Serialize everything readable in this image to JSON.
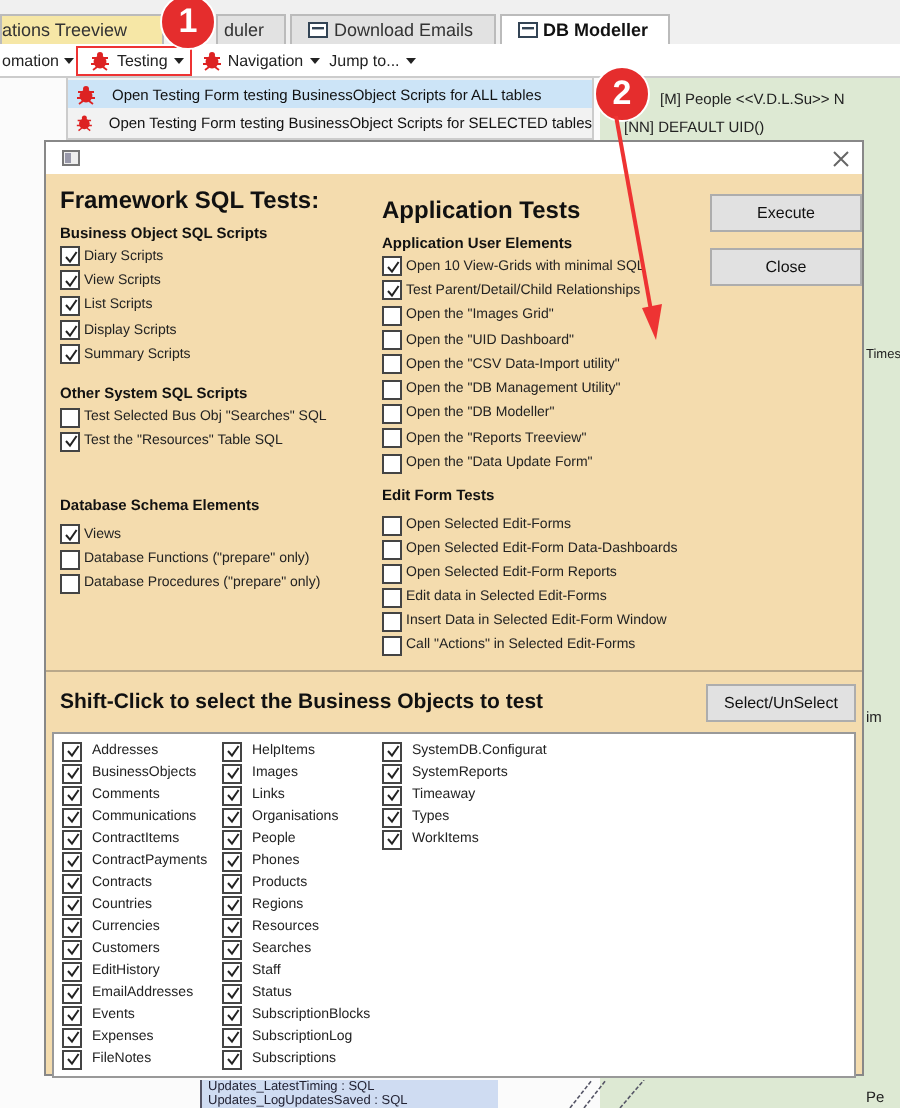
{
  "app": {
    "tabs": [
      {
        "label": "ations Treeview",
        "selected": false,
        "has_icon": false
      },
      {
        "label": "duler",
        "selected": false,
        "has_icon": false
      },
      {
        "label": "Download Emails",
        "selected": false,
        "has_icon": true
      },
      {
        "label": "DB Modeller",
        "selected": true,
        "has_icon": true
      }
    ],
    "toolbar": [
      {
        "label": "omation",
        "has_icon": false,
        "highlighted": false
      },
      {
        "label": "Testing",
        "has_icon": true,
        "highlighted": true
      },
      {
        "label": "Navigation",
        "has_icon": true,
        "highlighted": false
      },
      {
        "label": "Jump to...",
        "has_icon": false,
        "highlighted": false
      }
    ],
    "diagram_texts": [
      {
        "text": "[M] People <<V.D.L.Su>> N",
        "kind": "header"
      },
      {
        "text": "[NN] DEFAULT UID()",
        "kind": "field"
      },
      {
        "text": "Times",
        "kind": "side"
      },
      {
        "text": "im",
        "kind": "side2"
      },
      {
        "text": "Pe",
        "kind": "side3"
      }
    ],
    "diagram_rows": [
      "Updates_LatestTiming : SQL",
      "Updates_LogUpdatesSaved : SQL"
    ]
  },
  "menu": {
    "items": [
      {
        "label": "Open Testing Form testing BusinessObject Scripts for ALL tables",
        "selected": true
      },
      {
        "label": "Open Testing Form testing BusinessObject Scripts for SELECTED tables",
        "selected": false
      }
    ]
  },
  "dialog": {
    "sections": [
      {
        "title": "Framework SQL Tests:",
        "groups": [
          {
            "title": "Business Object SQL Scripts",
            "options": [
              {
                "label": "Diary Scripts",
                "checked": true
              },
              {
                "label": "View Scripts",
                "checked": true
              },
              {
                "label": "List Scripts",
                "checked": true
              },
              {
                "label": "Display Scripts",
                "checked": true
              },
              {
                "label": "Summary Scripts",
                "checked": true
              }
            ]
          },
          {
            "title": "Other System SQL Scripts",
            "options": [
              {
                "label": "Test Selected Bus Obj \"Searches\" SQL",
                "checked": false
              },
              {
                "label": "Test the \"Resources\" Table SQL",
                "checked": true
              }
            ]
          },
          {
            "title": "Database Schema Elements",
            "options": [
              {
                "label": "Views",
                "checked": true
              },
              {
                "label": "Database Functions (\"prepare\" only)",
                "checked": false
              },
              {
                "label": "Database Procedures (\"prepare\" only)",
                "checked": false
              }
            ]
          }
        ]
      },
      {
        "title": "Application Tests",
        "groups": [
          {
            "title": "Application User Elements",
            "options": [
              {
                "label": "Open 10 View-Grids with minimal SQL",
                "checked": true
              },
              {
                "label": "Test Parent/Detail/Child Relationships",
                "checked": true
              },
              {
                "label": "Open the \"Images Grid\"",
                "checked": false
              },
              {
                "label": "Open the \"UID Dashboard\"",
                "checked": false
              },
              {
                "label": "Open the \"CSV Data-Import utility\"",
                "checked": false
              },
              {
                "label": "Open the \"DB Management Utility\"",
                "checked": false
              },
              {
                "label": "Open the \"DB Modeller\"",
                "checked": false
              },
              {
                "label": "Open the \"Reports Treeview\"",
                "checked": false
              },
              {
                "label": "Open the \"Data Update Form\"",
                "checked": false
              }
            ]
          },
          {
            "title": "Edit Form Tests",
            "options": [
              {
                "label": "Open Selected Edit-Forms",
                "checked": false
              },
              {
                "label": "Open Selected Edit-Form Data-Dashboards",
                "checked": false
              },
              {
                "label": "Open Selected Edit-Form Reports",
                "checked": false
              },
              {
                "label": "Edit data in Selected Edit-Forms",
                "checked": false
              },
              {
                "label": "Insert Data in Selected Edit-Form Window",
                "checked": false
              },
              {
                "label": "Call \"Actions\" in Selected Edit-Forms",
                "checked": false
              }
            ]
          }
        ]
      }
    ],
    "buttons": [
      "Execute",
      "Close"
    ],
    "objects": {
      "title": "Shift-Click to select the Business Objects to test",
      "button": "Select/UnSelect",
      "columns": [
        [
          {
            "label": "Addresses",
            "checked": true
          },
          {
            "label": "BusinessObjects",
            "checked": true
          },
          {
            "label": "Comments",
            "checked": true
          },
          {
            "label": "Communications",
            "checked": true
          },
          {
            "label": "ContractItems",
            "checked": true
          },
          {
            "label": "ContractPayments",
            "checked": true
          },
          {
            "label": "Contracts",
            "checked": true
          },
          {
            "label": "Countries",
            "checked": true
          },
          {
            "label": "Currencies",
            "checked": true
          },
          {
            "label": "Customers",
            "checked": true
          },
          {
            "label": "EditHistory",
            "checked": true
          },
          {
            "label": "EmailAddresses",
            "checked": true
          },
          {
            "label": "Events",
            "checked": true
          },
          {
            "label": "Expenses",
            "checked": true
          },
          {
            "label": "FileNotes",
            "checked": true
          }
        ],
        [
          {
            "label": "HelpItems",
            "checked": true
          },
          {
            "label": "Images",
            "checked": true
          },
          {
            "label": "Links",
            "checked": true
          },
          {
            "label": "Organisations",
            "checked": true
          },
          {
            "label": "People",
            "checked": true
          },
          {
            "label": "Phones",
            "checked": true
          },
          {
            "label": "Products",
            "checked": true
          },
          {
            "label": "Regions",
            "checked": true
          },
          {
            "label": "Resources",
            "checked": true
          },
          {
            "label": "Searches",
            "checked": true
          },
          {
            "label": "Staff",
            "checked": true
          },
          {
            "label": "Status",
            "checked": true
          },
          {
            "label": "SubscriptionBlocks",
            "checked": true
          },
          {
            "label": "SubscriptionLog",
            "checked": true
          },
          {
            "label": "Subscriptions",
            "checked": true
          }
        ],
        [
          {
            "label": "SystemDB.Configurat",
            "checked": true
          },
          {
            "label": "SystemReports",
            "checked": true
          },
          {
            "label": "Timeaway",
            "checked": true
          },
          {
            "label": "Types",
            "checked": true
          },
          {
            "label": "WorkItems",
            "checked": true
          }
        ]
      ]
    }
  },
  "annotations": [
    {
      "label": "1"
    },
    {
      "label": "2"
    }
  ]
}
